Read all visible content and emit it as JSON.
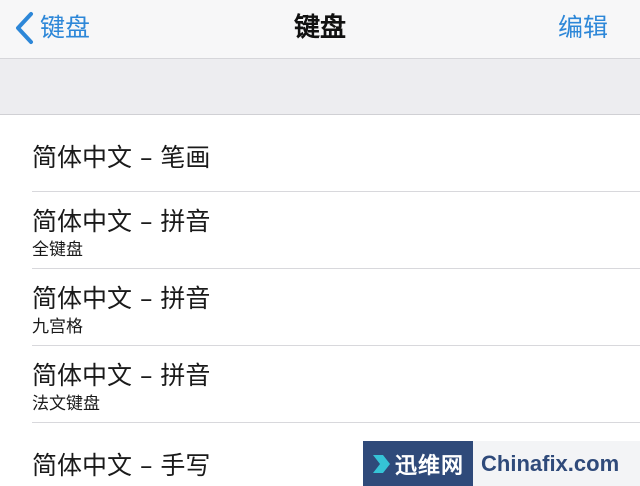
{
  "navbar": {
    "back_label": "键盘",
    "title": "键盘",
    "edit_label": "编辑"
  },
  "keyboards": [
    {
      "title": "简体中文 – 笔画",
      "subtitle": ""
    },
    {
      "title": "简体中文 – 拼音",
      "subtitle": "全键盘"
    },
    {
      "title": "简体中文 – 拼音",
      "subtitle": "九宫格"
    },
    {
      "title": "简体中文 – 拼音",
      "subtitle": "法文键盘"
    },
    {
      "title": "简体中文 – 手写",
      "subtitle": ""
    }
  ],
  "watermark": {
    "cn_text": "迅维网",
    "en_text": "Chinafix.com"
  },
  "colors": {
    "accent": "#2d87d8",
    "navbar_bg": "#f7f7f8",
    "section_bg": "#ededf0",
    "watermark_dark": "#2f4a7a",
    "watermark_cyan": "#35c3d6"
  }
}
